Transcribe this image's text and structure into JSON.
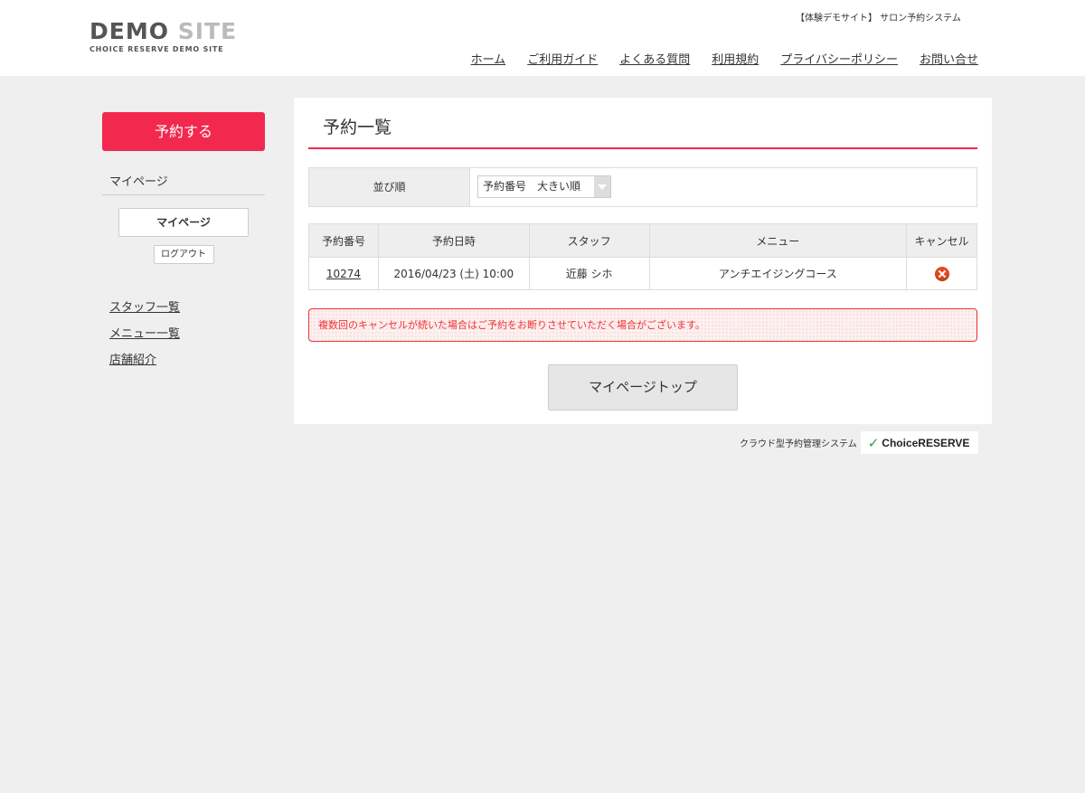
{
  "header": {
    "logo_demo": "DEMO",
    "logo_site": "SITE",
    "logo_sub": "CHOICE RESERVE DEMO SITE",
    "tagline": "【体験デモサイト】 サロン予約システム",
    "nav": [
      "ホーム",
      "ご利用ガイド",
      "よくある質問",
      "利用規約",
      "プライバシーポリシー",
      "お問い合せ"
    ]
  },
  "sidebar": {
    "reserve_label": "予約する",
    "mypage_heading": "マイページ",
    "mypage_button": "マイページ",
    "logout_button": "ログアウト",
    "links": [
      "スタッフ一覧",
      "メニュー一覧",
      "店舗紹介"
    ]
  },
  "main": {
    "title": "予約一覧",
    "sort_label": "並び順",
    "sort_value": "予約番号　大きい順",
    "table": {
      "headers": [
        "予約番号",
        "予約日時",
        "スタッフ",
        "メニュー",
        "キャンセル"
      ],
      "rows": [
        {
          "id": "10274",
          "datetime": "2016/04/23 (土) 10:00",
          "staff": "近藤 シホ",
          "menu": "アンチエイジングコース"
        }
      ]
    },
    "warning": "複数回のキャンセルが続いた場合はご予約をお断りさせていただく場合がございます。",
    "top_button": "マイページトップ"
  },
  "footer": {
    "text": "クラウド型予約管理システム",
    "brand_mark": "✓",
    "brand_name": "ChoiceRESERVE"
  },
  "colors": {
    "accent": "#f2284e",
    "warning": "#ee3333",
    "cancel_icon": "#e24a1f"
  }
}
